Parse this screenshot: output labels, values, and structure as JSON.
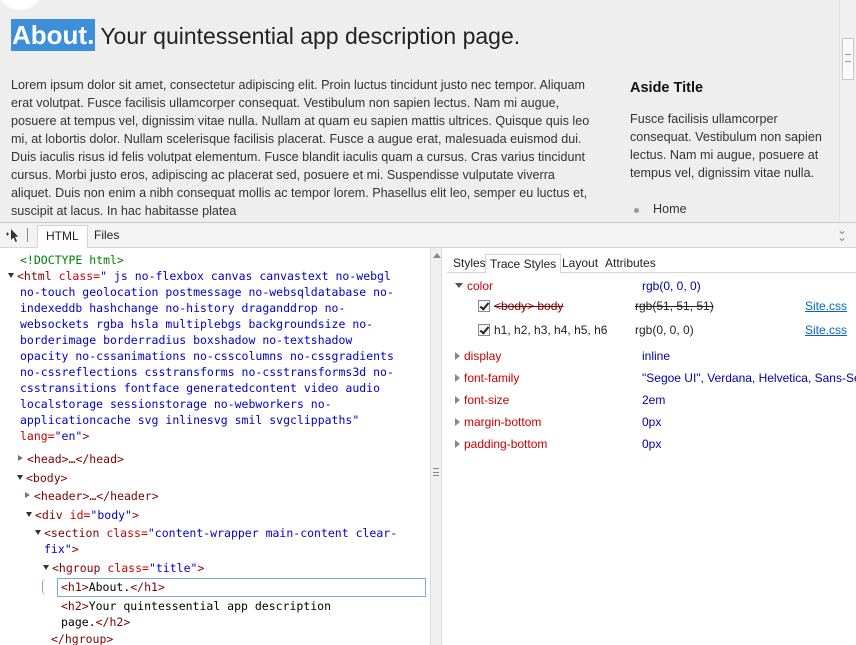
{
  "page": {
    "h1": "About.",
    "h2": "Your quintessential app description page.",
    "lorem": "Lorem ipsum dolor sit amet, consectetur adipiscing elit. Proin luctus tincidunt justo nec tempor. Aliquam erat volutpat. Fusce facilisis ullamcorper consequat. Vestibulum non sapien lectus. Nam mi augue, posuere at tempus vel, dignissim vitae nulla. Nullam at quam eu sapien mattis ultrices. Quisque quis leo mi, at lobortis dolor. Nullam scelerisque facilisis placerat. Fusce a augue erat, malesuada euismod dui. Duis iaculis risus id felis volutpat elementum. Fusce blandit iaculis quam a cursus. Cras varius tincidunt cursus. Morbi justo eros, adipiscing ac placerat sed, posuere et mi. Suspendisse vulputate viverra aliquet. Duis non enim a nibh consequat mollis ac tempor lorem. Phasellus elit leo, semper eu luctus et, suscipit at lacus. In hac habitasse platea",
    "aside_title": "Aside Title",
    "aside_text": "Fusce facilisis ullamcorper consequat. Vestibulum non sapien lectus. Nam mi augue, posuere at tempus vel, dignissim vitae nulla.",
    "aside_link": "Home"
  },
  "devtools": {
    "tabs": [
      "HTML",
      "Files"
    ],
    "active_tab": "HTML",
    "dom": {
      "doctype": "<!DOCTYPE html>",
      "html_open": "<html",
      "html_class_attr": "class=",
      "html_class_lines": [
        "\" js no-flexbox canvas canvastext no-webgl",
        "no-touch geolocation postmessage no-websqldatabase no-",
        "indexeddb hashchange no-history draganddrop no-",
        "websockets rgba hsla multiplebgs backgroundsize no-",
        "borderimage borderradius boxshadow no-textshadow",
        "opacity no-cssanimations no-csscolumns no-cssgradients",
        "no-cssreflections csstransforms no-csstransforms3d no-",
        "csstransitions fontface generatedcontent video audio",
        "localstorage sessionstorage no-webworkers no-",
        "applicationcache svg inlinesvg smil svgclippaths\""
      ],
      "html_lang_attr": "lang=",
      "html_lang_val": "\"en\"",
      "html_close": ">",
      "head": "<head>…</head>",
      "body": "<body>",
      "header": "<header>…</header>",
      "div_open": "<div",
      "div_id_attr": "id=",
      "div_id_val": "\"body\"",
      "div_close": ">",
      "section_open": "<section",
      "section_class_attr": "class=",
      "section_class_val1": "\"content-wrapper main-content clear-",
      "section_class_val2": "fix\"",
      "section_close": ">",
      "hgroup_open": "<hgroup",
      "hgroup_class_attr": "class=",
      "hgroup_class_val": "\"title\"",
      "hgroup_close": ">",
      "h1_open": "<h1>",
      "h1_text": "About.",
      "h1_close": "</h1>",
      "h2_open": "<h2>",
      "h2_text1": "Your quintessential app description",
      "h2_text2": "page.",
      "h2_close": "</h2>",
      "hgroup_end": "</hgroup>"
    },
    "styles_tabs": [
      "Styles",
      "Trace Styles",
      "Layout",
      "Attributes"
    ],
    "active_styles_tab": "Trace Styles",
    "trace": [
      {
        "name": "color",
        "value": "rgb(0, 0, 0)",
        "expanded": true,
        "rules": [
          {
            "selector": "<body> body",
            "value": "rgb(51, 51, 51)",
            "source": "Site.css",
            "overridden": true
          },
          {
            "selector": "h1, h2, h3, h4, h5, h6",
            "value": "rgb(0, 0, 0)",
            "source": "Site.css",
            "overridden": false
          }
        ]
      },
      {
        "name": "display",
        "value": "inline"
      },
      {
        "name": "font-family",
        "value": "\"Segoe UI\", Verdana, Helvetica, Sans-Serif"
      },
      {
        "name": "font-size",
        "value": "2em"
      },
      {
        "name": "margin-bottom",
        "value": "0px"
      },
      {
        "name": "padding-bottom",
        "value": "0px"
      }
    ]
  }
}
